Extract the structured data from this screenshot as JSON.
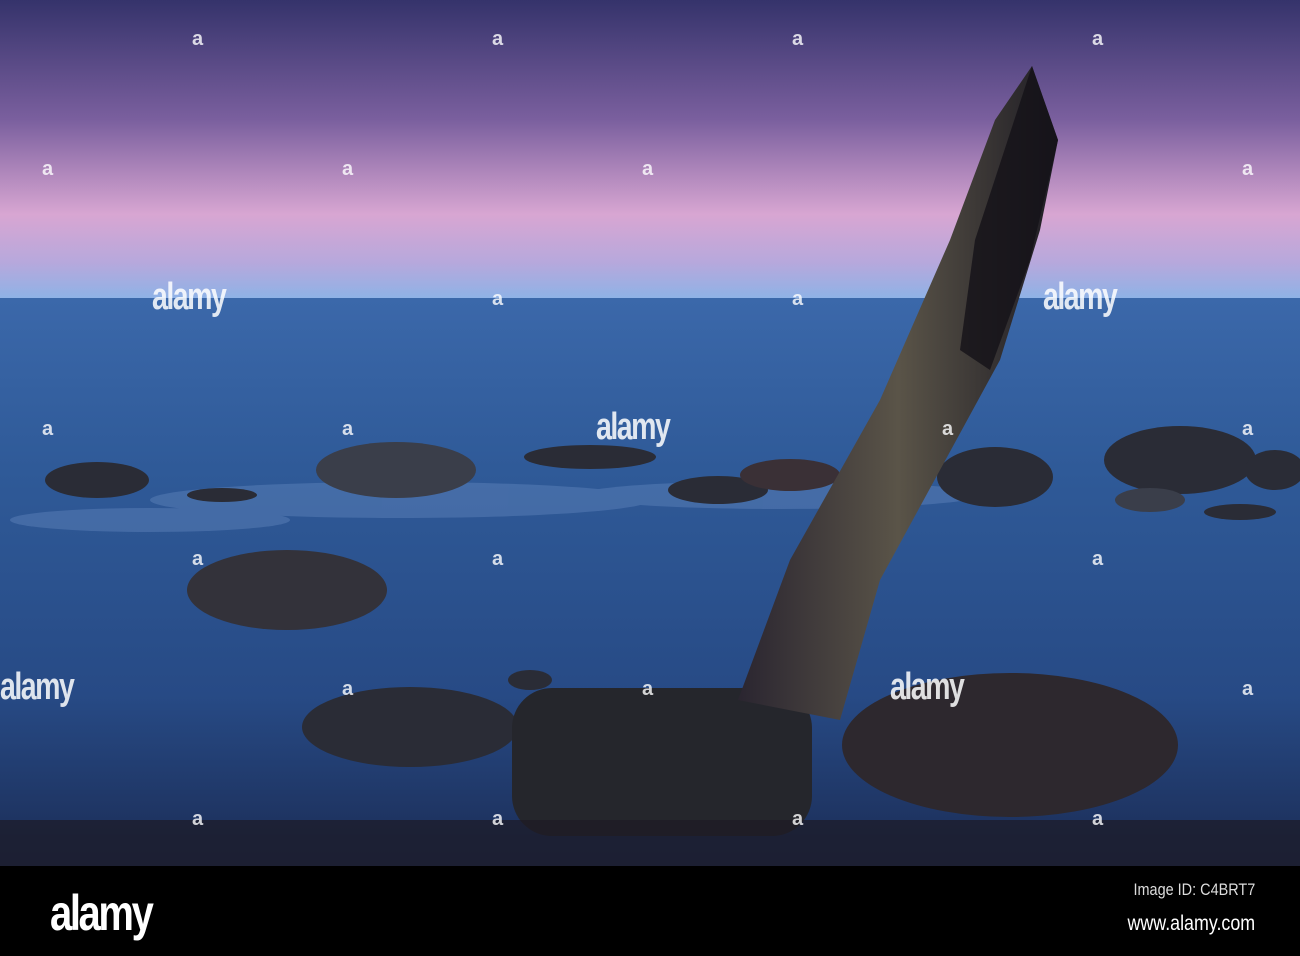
{
  "footer": {
    "logo": "alamy",
    "image_id": "Image ID: C4BRT7",
    "website": "www.alamy.com"
  },
  "watermark": {
    "text": "alamy",
    "mark": "a"
  },
  "colors": {
    "sky_top": "#35336b",
    "sky_pink": "#d8a6d2",
    "horizon": "#8fb2e6",
    "sea": "#2f5a98",
    "rock": "#2a2c36"
  }
}
